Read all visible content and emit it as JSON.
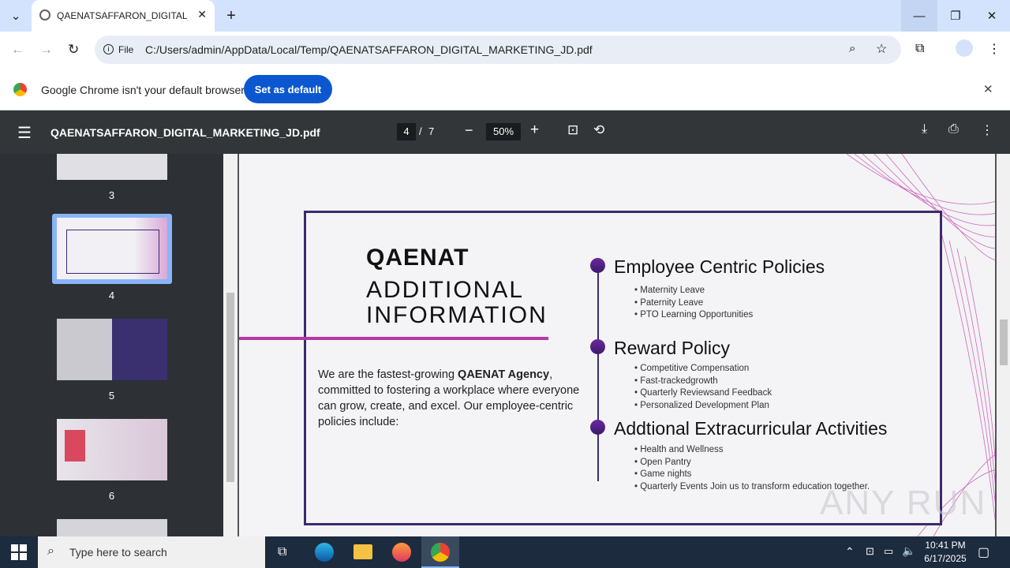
{
  "browser": {
    "tab_title": "QAENATSAFFARON_DIGITAL_M",
    "file_label": "File",
    "url": "C:/Users/admin/AppData/Local/Temp/QAENATSAFFARON_DIGITAL_MARKETING_JD.pdf"
  },
  "infobar": {
    "message": "Google Chrome isn't your default browser",
    "button": "Set as default"
  },
  "pdf": {
    "filename": "QAENATSAFFARON_DIGITAL_MARKETING_JD.pdf",
    "page": "4",
    "separator": "/",
    "total": "7",
    "zoom": "50%"
  },
  "thumbs": [
    {
      "num": "3"
    },
    {
      "num": "4"
    },
    {
      "num": "5"
    },
    {
      "num": "6"
    }
  ],
  "slide": {
    "brand": "QAENAT",
    "heading1": "ADDITIONAL",
    "heading2": "INFORMATION",
    "intro_pre": "We are the fastest-growing ",
    "intro_bold": "QAENAT Agency",
    "intro_post": ", committed to fostering a workplace where everyone can grow, create, and excel. Our employee-centric policies include:",
    "sections": [
      {
        "title": "Employee Centric Policies",
        "items": [
          "Maternity Leave",
          "Paternity Leave",
          "PTO Learning Opportunities"
        ]
      },
      {
        "title": "Reward Policy",
        "items": [
          "Competitive Compensation",
          "Fast-trackedgrowth",
          "Quarterly Reviewsand Feedback",
          "Personalized Development Plan"
        ]
      },
      {
        "title": "Addtional Extracurricular Activities",
        "items": [
          "Health and Wellness",
          "Open Pantry",
          "Game nights",
          "Quarterly Events Join us to transform education together."
        ]
      }
    ],
    "watermark": "ANY RUN"
  },
  "taskbar": {
    "search_placeholder": "Type here to search",
    "time": "10:41 PM",
    "date": "6/17/2025"
  }
}
